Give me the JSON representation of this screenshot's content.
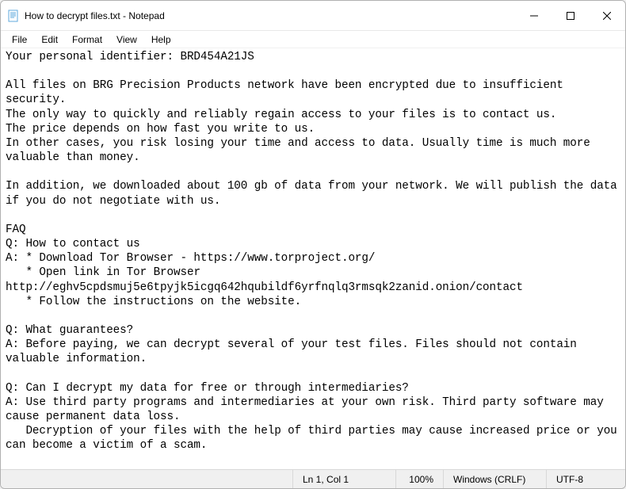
{
  "titlebar": {
    "title": "How to decrypt files.txt - Notepad"
  },
  "menubar": {
    "file": "File",
    "edit": "Edit",
    "format": "Format",
    "view": "View",
    "help": "Help"
  },
  "content": "Your personal identifier: BRD454A21JS\n\nAll files on BRG Precision Products network have been encrypted due to insufficient security.\nThe only way to quickly and reliably regain access to your files is to contact us.\nThe price depends on how fast you write to us.\nIn other cases, you risk losing your time and access to data. Usually time is much more valuable than money.\n\nIn addition, we downloaded about 100 gb of data from your network. We will publish the data if you do not negotiate with us.\n\nFAQ\nQ: How to contact us\nA: * Download Tor Browser - https://www.torproject.org/\n   * Open link in Tor Browser http://eghv5cpdsmuj5e6tpyjk5icgq642hqubildf6yrfnqlq3rmsqk2zanid.onion/contact\n   * Follow the instructions on the website.\n\nQ: What guarantees?\nA: Before paying, we can decrypt several of your test files. Files should not contain valuable information.\n\nQ: Can I decrypt my data for free or through intermediaries?\nA: Use third party programs and intermediaries at your own risk. Third party software may cause permanent data loss.\n   Decryption of your files with the help of third parties may cause increased price or you can become a victim of a scam.",
  "statusbar": {
    "position": "Ln 1, Col 1",
    "zoom": "100%",
    "eol": "Windows (CRLF)",
    "encoding": "UTF-8"
  }
}
